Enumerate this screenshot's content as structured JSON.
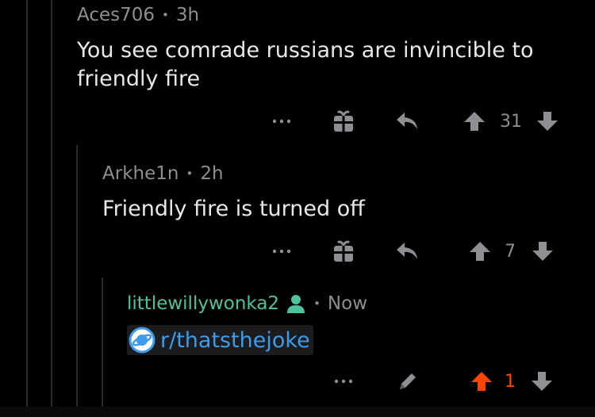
{
  "comments": [
    {
      "author": "Aces706",
      "time": "3h",
      "text": "You see comrade russians are invincible to friendly fire",
      "score": "31"
    },
    {
      "author": "Arkhe1n",
      "time": "2h",
      "text": "Friendly fire is turned off",
      "score": "7"
    },
    {
      "author": "littlewillywonka2",
      "time": "Now",
      "link_text": "r/thatsthejoke",
      "score": "1"
    }
  ],
  "colors": {
    "upvoted": "#ff4500",
    "op_badge": "#4fc3a1",
    "link": "#3d9bea"
  },
  "icons": [
    "more-options-icon",
    "gift-icon",
    "reply-icon",
    "upvote-arrow-icon",
    "downvote-arrow-icon",
    "user-op-icon",
    "subreddit-planet-icon",
    "edit-pencil-icon"
  ]
}
